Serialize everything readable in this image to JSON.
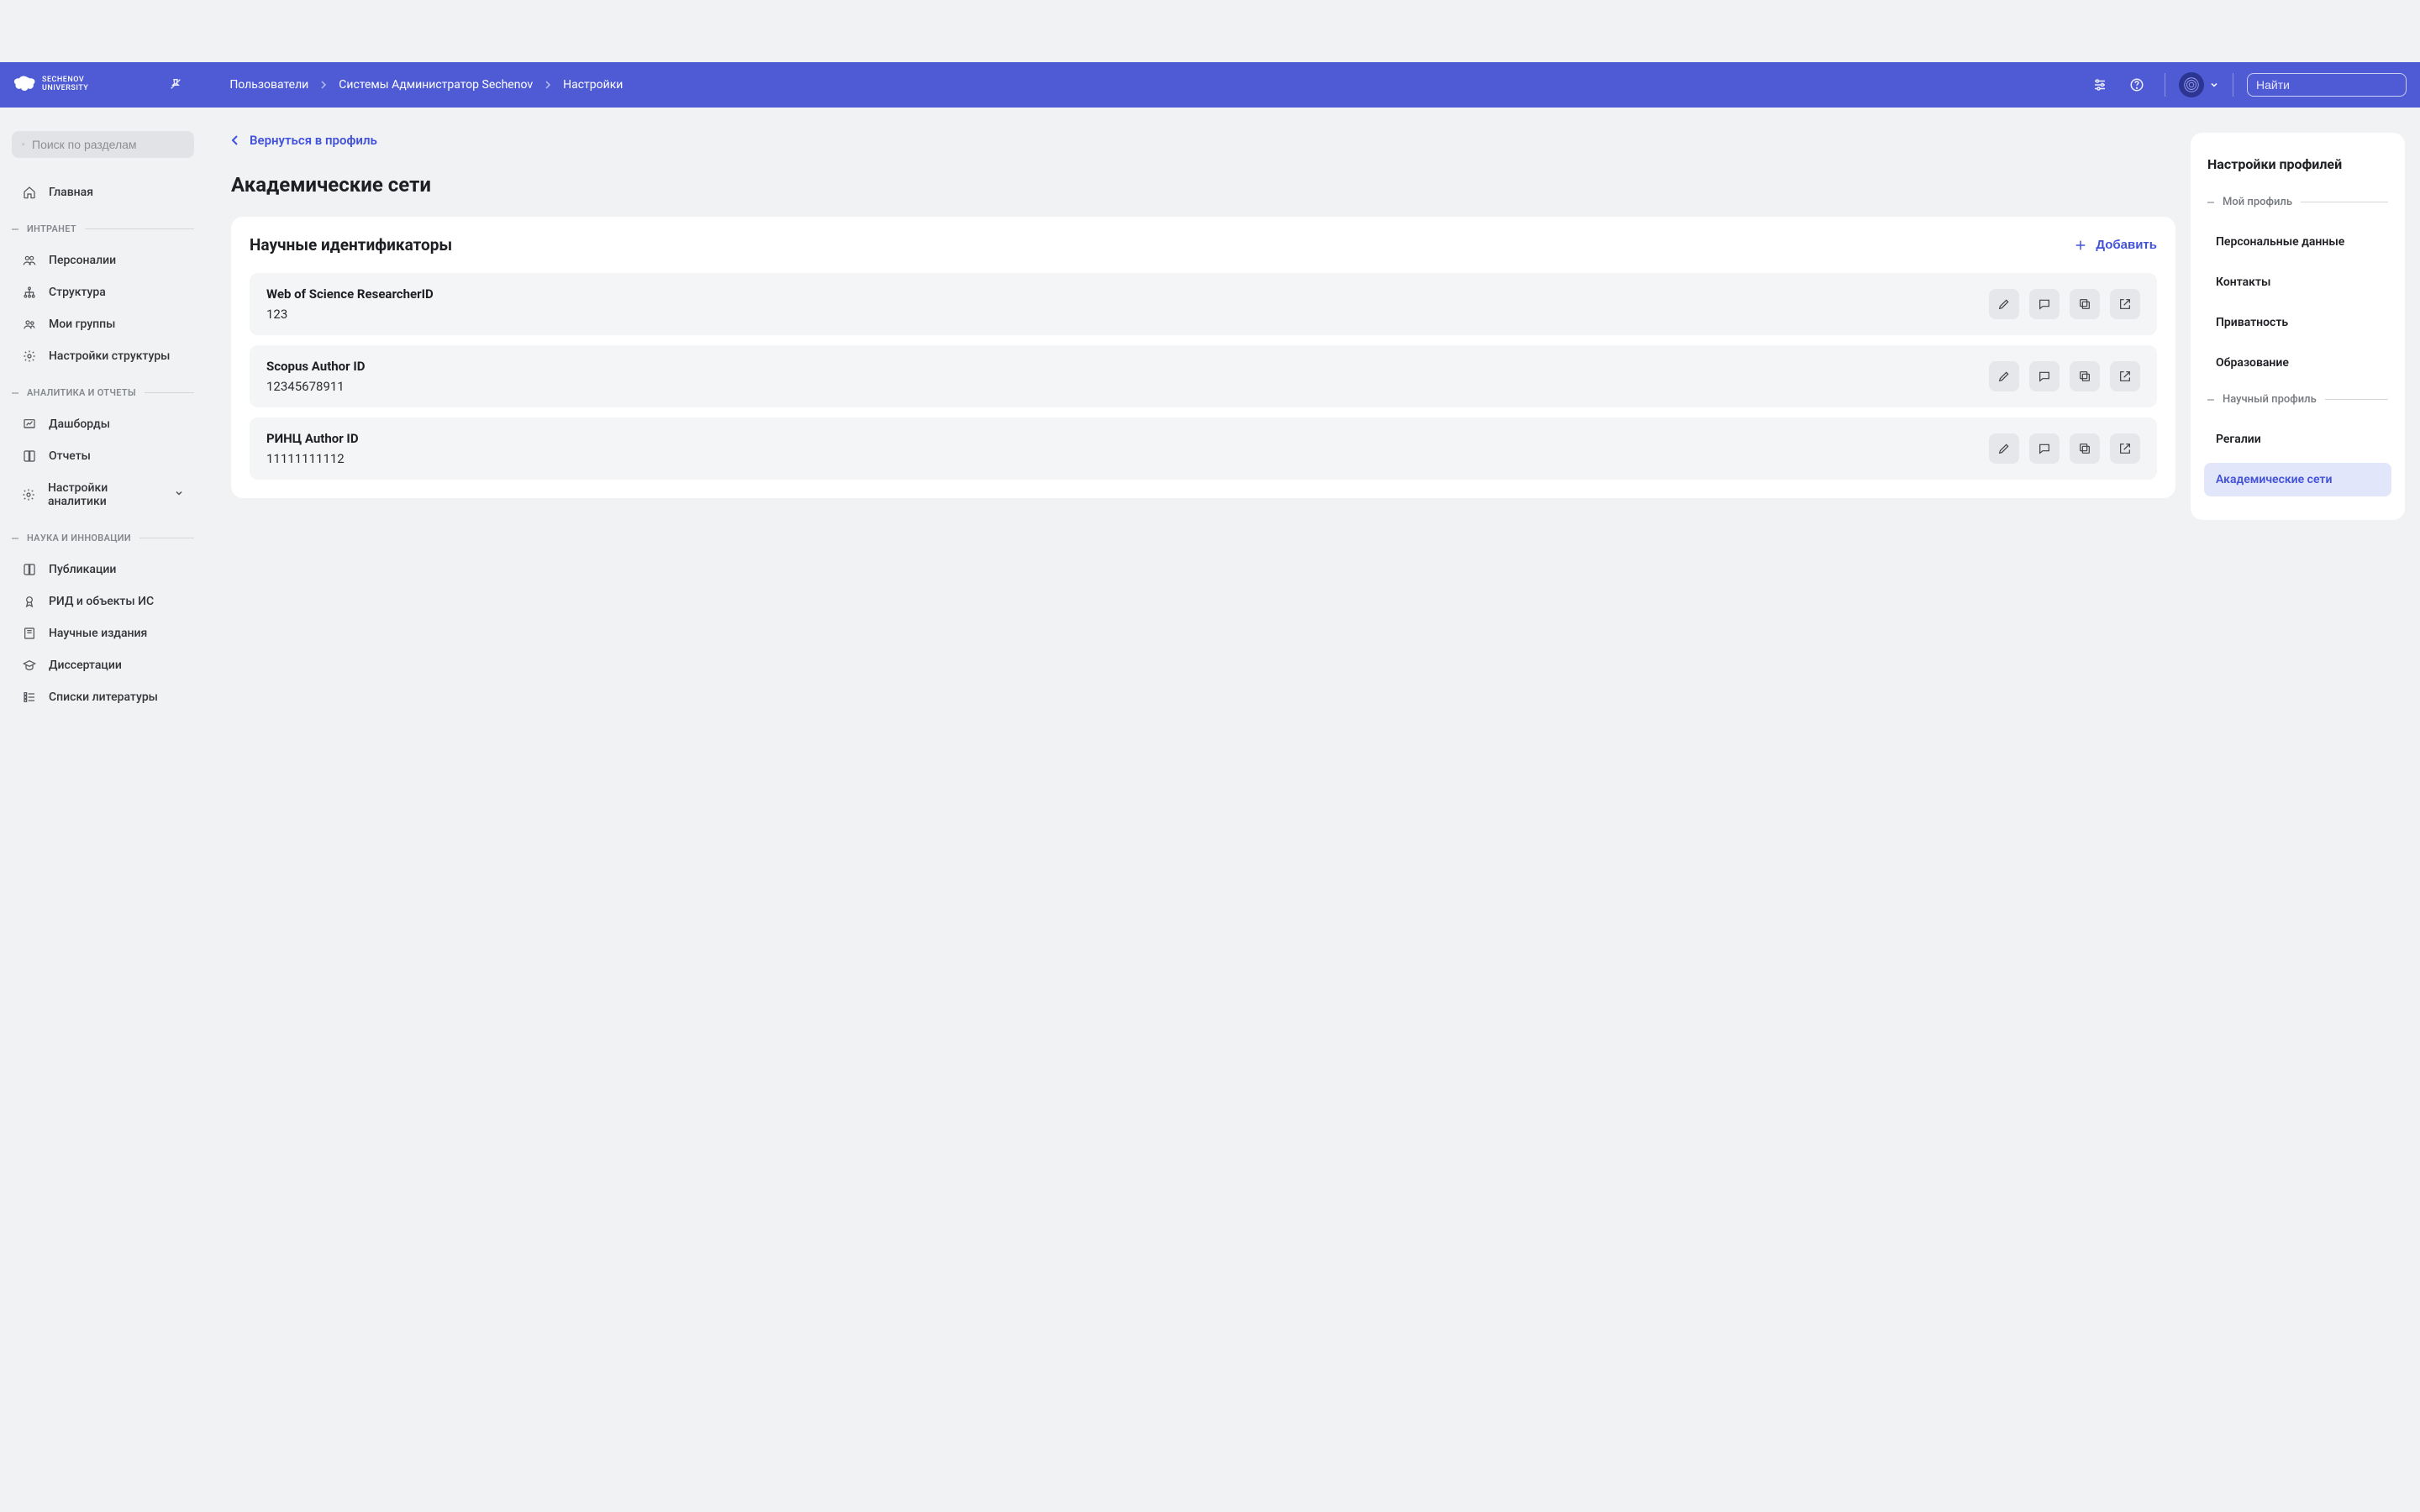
{
  "header": {
    "brand_line1": "SECHENOV",
    "brand_line2": "UNIVERSITY",
    "breadcrumb": [
      "Пользователи",
      "Системы Администратор Sechenov",
      "Настройки"
    ],
    "search_placeholder": "Найти"
  },
  "sidebar": {
    "search_placeholder": "Поиск по разделам",
    "home": "Главная",
    "section_intranet": "ИНТРАНЕТ",
    "intranet_items": [
      "Персоналии",
      "Структура",
      "Мои группы",
      "Настройки структуры"
    ],
    "section_analytics": "АНАЛИТИКА И ОТЧЕТЫ",
    "analytics_items": [
      "Дашборды",
      "Отчеты",
      "Настройки аналитики"
    ],
    "section_science": "НАУКА И ИННОВАЦИИ",
    "science_items": [
      "Публикации",
      "РИД и объекты ИС",
      "Научные издания",
      "Диссертации",
      "Списки литературы"
    ]
  },
  "main": {
    "back_link": "Вернуться в профиль",
    "page_title": "Академические сети",
    "card_title": "Научные идентификаторы",
    "add_label": "Добавить",
    "identifiers": [
      {
        "name": "Web of Science ResearcherID",
        "value": "123"
      },
      {
        "name": "Scopus Author ID",
        "value": "12345678911"
      },
      {
        "name": "РИНЦ Author ID",
        "value": "11111111112"
      }
    ]
  },
  "settings_panel": {
    "title": "Настройки профилей",
    "section_my": "Мой профиль",
    "my_items": [
      "Персональные данные",
      "Контакты",
      "Приватность",
      "Образование"
    ],
    "section_sci": "Научный профиль",
    "sci_items": [
      "Регалии",
      "Академические сети"
    ],
    "active": "Академические сети"
  },
  "colors": {
    "primary": "#4f5bd5",
    "link": "#4252d9"
  }
}
